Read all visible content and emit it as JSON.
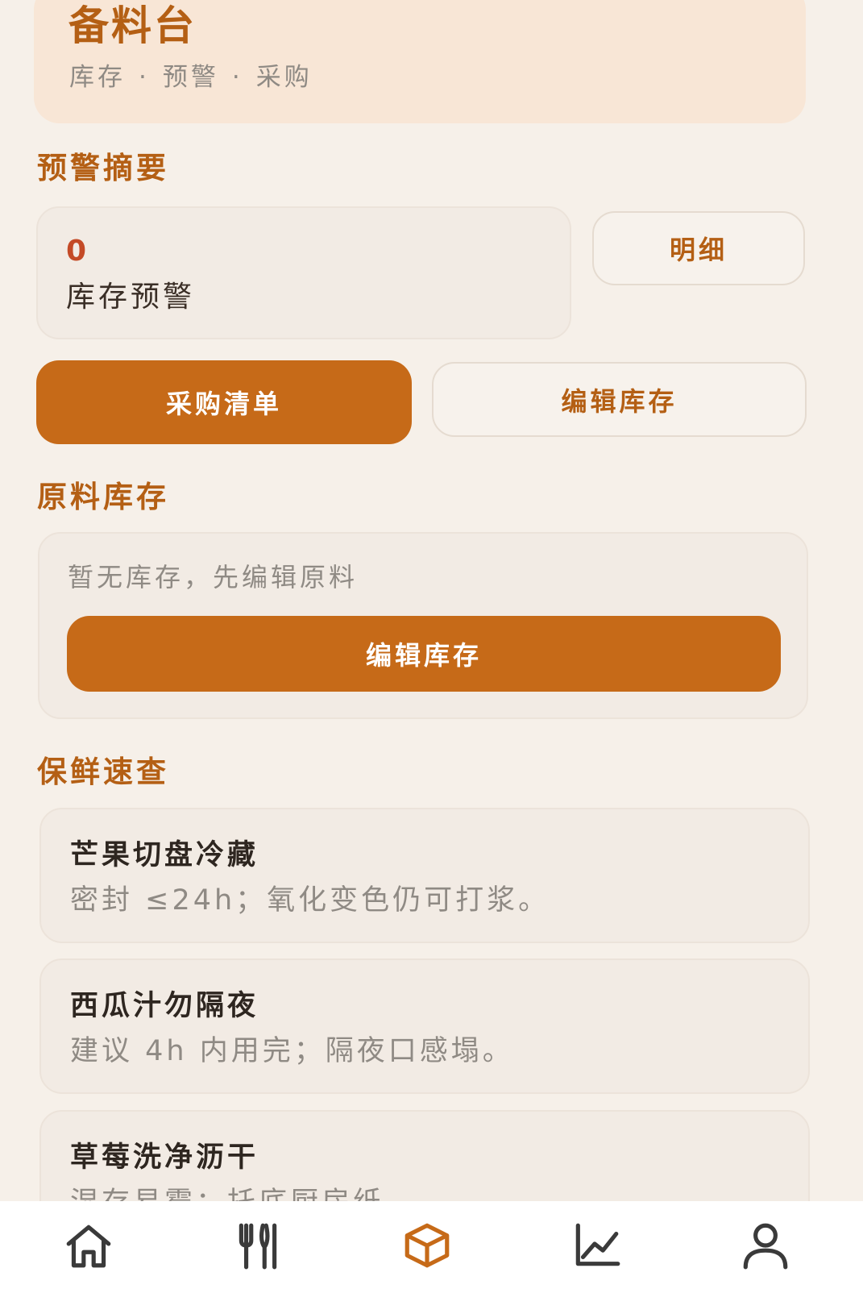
{
  "header": {
    "title": "备料台",
    "subtitle_items": [
      "库存",
      "预警",
      "采购"
    ],
    "subtitle_separator": "·"
  },
  "alerts": {
    "section_title": "预警摘要",
    "count": "0",
    "label": "库存预警",
    "detail_button": "明细"
  },
  "actions": {
    "purchase_list": "采购清单",
    "edit_stock": "编辑库存"
  },
  "stock": {
    "section_title": "原料库存",
    "empty_text": "暂无库存，先编辑原料",
    "edit_button": "编辑库存"
  },
  "freshness": {
    "section_title": "保鲜速查",
    "tips": [
      {
        "title": "芒果切盘冷藏",
        "desc": "密封 ≤24h；氧化变色仍可打浆。"
      },
      {
        "title": "西瓜汁勿隔夜",
        "desc": "建议 4h 内用完；隔夜口感塌。"
      },
      {
        "title": "草莓洗净沥干",
        "desc": "湿存易霉；托底厨房纸"
      }
    ]
  },
  "tabbar": {
    "tabs": [
      {
        "icon": "home-icon",
        "active": false
      },
      {
        "icon": "utensils-icon",
        "active": false
      },
      {
        "icon": "box-icon",
        "active": true
      },
      {
        "icon": "chart-icon",
        "active": false
      },
      {
        "icon": "user-icon",
        "active": false
      }
    ],
    "active_color": "#c66a18",
    "inactive_color": "#3a3a3a"
  },
  "colors": {
    "accent": "#c66a18",
    "heading": "#b45f14",
    "alert_count": "#c44a26"
  }
}
